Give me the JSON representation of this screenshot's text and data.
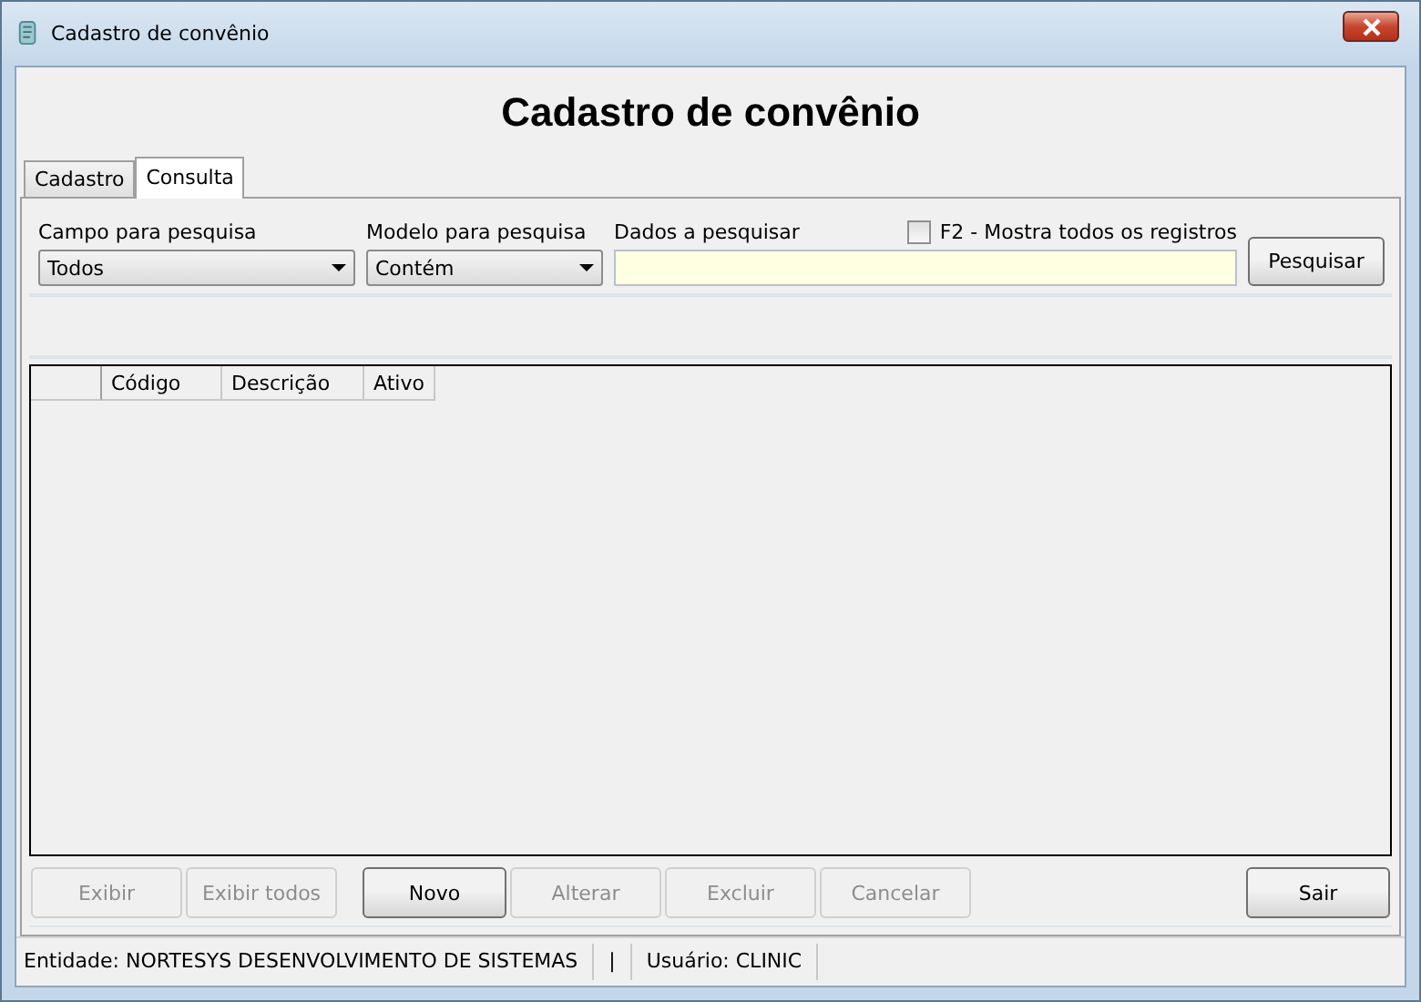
{
  "window": {
    "title": "Cadastro de convênio"
  },
  "heading": "Cadastro de convênio",
  "tabs": [
    {
      "label": "Cadastro",
      "selected": false
    },
    {
      "label": "Consulta",
      "selected": true
    }
  ],
  "search": {
    "field_label": "Campo para pesquisa",
    "field_value": "Todos",
    "model_label": "Modelo para pesquisa",
    "model_value": "Contém",
    "data_label": "Dados a pesquisar",
    "show_all": {
      "label": "F2 - Mostra todos os registros",
      "checked": false
    },
    "button": "Pesquisar"
  },
  "table": {
    "columns": [
      "Código",
      "Descrição",
      "Ativo"
    ]
  },
  "buttons": [
    {
      "label": "Exibir",
      "disabled": true
    },
    {
      "label": "Exibir todos",
      "disabled": true
    },
    {
      "label": "Novo",
      "disabled": false
    },
    {
      "label": "Alterar",
      "disabled": true
    },
    {
      "label": "Excluir",
      "disabled": true
    },
    {
      "label": "Cancelar",
      "disabled": true
    }
  ],
  "exit_button": {
    "label": "Sair",
    "disabled": false
  },
  "status_bar": [
    "Entidade: NORTESYS DESENVOLVIMENTO DE SISTEMAS",
    "|",
    "Usuário: CLINIC"
  ]
}
